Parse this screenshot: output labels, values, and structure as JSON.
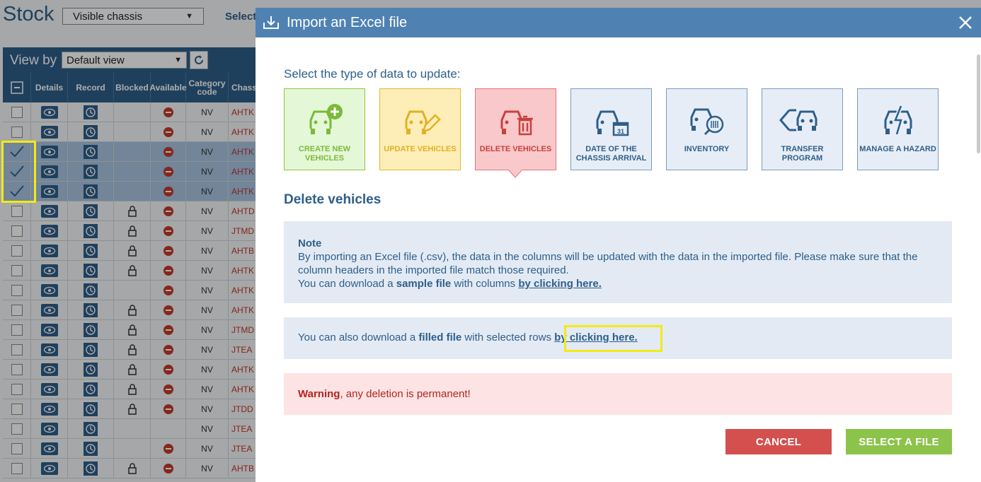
{
  "page": {
    "title": "Stock",
    "chassis_filter": "Visible chassis",
    "select_label": "Select",
    "view_by_label": "View by",
    "view_select": "Default view"
  },
  "table": {
    "headers": [
      "",
      "Details",
      "Record",
      "Blocked",
      "Available",
      "Category code",
      "Chassis"
    ],
    "rows": [
      {
        "checked": false,
        "blocked": false,
        "available": true,
        "category": "NV",
        "chassis": "AHTK"
      },
      {
        "checked": false,
        "blocked": false,
        "available": true,
        "category": "NV",
        "chassis": "AHTK"
      },
      {
        "checked": true,
        "blocked": false,
        "available": true,
        "category": "NV",
        "chassis": "AHTK"
      },
      {
        "checked": true,
        "blocked": false,
        "available": true,
        "category": "NV",
        "chassis": "AHTK"
      },
      {
        "checked": true,
        "blocked": false,
        "available": true,
        "category": "NV",
        "chassis": "AHTK"
      },
      {
        "checked": false,
        "blocked": true,
        "available": true,
        "category": "NV",
        "chassis": "AHTD"
      },
      {
        "checked": false,
        "blocked": true,
        "available": true,
        "category": "NV",
        "chassis": "JTMD"
      },
      {
        "checked": false,
        "blocked": true,
        "available": true,
        "category": "NV",
        "chassis": "AHTB"
      },
      {
        "checked": false,
        "blocked": true,
        "available": true,
        "category": "NV",
        "chassis": "AHTK"
      },
      {
        "checked": false,
        "blocked": false,
        "available": true,
        "category": "NV",
        "chassis": "AHTK"
      },
      {
        "checked": false,
        "blocked": true,
        "available": true,
        "category": "NV",
        "chassis": "AHTK"
      },
      {
        "checked": false,
        "blocked": true,
        "available": true,
        "category": "NV",
        "chassis": "JTMD"
      },
      {
        "checked": false,
        "blocked": true,
        "available": true,
        "category": "NV",
        "chassis": "JTEA"
      },
      {
        "checked": false,
        "blocked": true,
        "available": true,
        "category": "NV",
        "chassis": "AHTK"
      },
      {
        "checked": false,
        "blocked": true,
        "available": true,
        "category": "NV",
        "chassis": "AHTK"
      },
      {
        "checked": false,
        "blocked": true,
        "available": true,
        "category": "NV",
        "chassis": "JTDD"
      },
      {
        "checked": false,
        "blocked": false,
        "available": false,
        "category": "NV",
        "chassis": "JTEA"
      },
      {
        "checked": false,
        "blocked": false,
        "available": true,
        "category": "NV",
        "chassis": "JTEA"
      },
      {
        "checked": false,
        "blocked": true,
        "available": true,
        "category": "NV",
        "chassis": "AHTB"
      }
    ]
  },
  "modal": {
    "title": "Import an Excel file",
    "type_label": "Select the type of data to update:",
    "tiles": [
      {
        "label": "Create new vehicles",
        "icon": "car-plus-icon"
      },
      {
        "label": "Update vehicles",
        "icon": "car-edit-icon"
      },
      {
        "label": "Delete vehicles",
        "icon": "car-trash-icon"
      },
      {
        "label": "Date of the chassis arrival",
        "icon": "car-calendar-icon"
      },
      {
        "label": "Inventory",
        "icon": "car-barcode-icon"
      },
      {
        "label": "Transfer program",
        "icon": "car-transfer-icon"
      },
      {
        "label": "Manage a hazard",
        "icon": "car-hazard-icon"
      }
    ],
    "section_title": "Delete vehicles",
    "note": {
      "title": "Note",
      "line1": "By importing an Excel file (.csv), the data in the columns will be updated with the data in the imported file. Please make sure that the column headers in the imported file match those required.",
      "line2_pre": "You can download a ",
      "line2_bold": "sample file",
      "line2_mid": " with columns ",
      "line2_link": "by clicking here."
    },
    "filled": {
      "pre": "You can also download a ",
      "bold": "filled file",
      "mid": " with selected rows ",
      "link": "by clicking here."
    },
    "warning": {
      "strong": "Warning",
      "text": ", any deletion is permanent!"
    },
    "buttons": {
      "cancel": "CANCEL",
      "select_file": "SELECT A FILE"
    },
    "colors": {
      "header": "#4f82b3",
      "create": "#8cc63f",
      "update": "#e3b82a",
      "delete": "#e37678",
      "neutral": "#2e5f8a",
      "cancel": "#d3504f",
      "select": "#8cc34a"
    }
  }
}
